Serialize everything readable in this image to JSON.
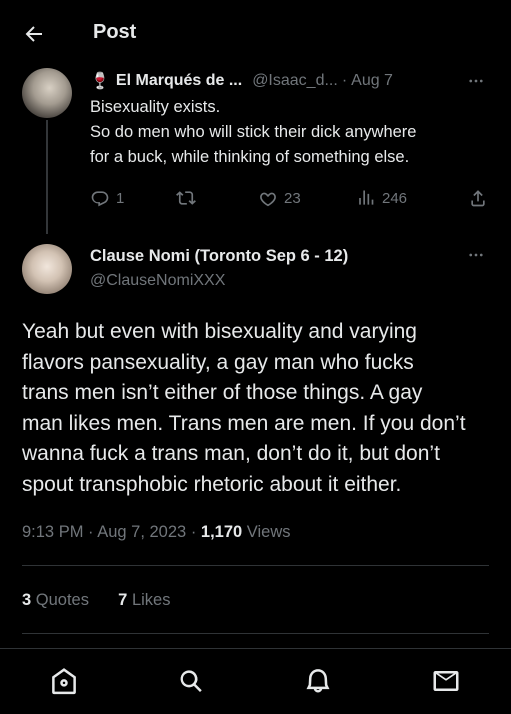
{
  "header": {
    "title": "Post"
  },
  "reply_post": {
    "author_emoji": "🍷",
    "author_name": "El Marqués de ...",
    "handle": "@Isaac_d...",
    "separator": "·",
    "date": "Aug 7",
    "body_lines": [
      "Bisexuality exists.",
      "So do men who will stick their dick anywhere",
      "for a buck, while thinking of something else."
    ],
    "actions": {
      "replies": "1",
      "retweets": "",
      "likes": "23",
      "views": "246"
    }
  },
  "main_post": {
    "author_name": "Clause Nomi (Toronto Sep 6 - 12)",
    "handle": "@ClauseNomiXXX",
    "body_lines": [
      "Yeah but even with bisexuality and varying",
      "flavors pansexuality, a gay man who fucks",
      "trans men isn’t either of those things. A gay",
      "man likes men. Trans men are men. If you don’t",
      "wanna fuck a trans man, don’t do it, but don’t",
      "spout transphobic rhetoric about it either."
    ],
    "time": "9:13 PM",
    "date": "Aug 7, 2023",
    "views_count": "1,170",
    "views_label": "Views",
    "quotes_count": "3",
    "quotes_label": "Quotes",
    "likes_count": "7",
    "likes_label": "Likes"
  },
  "icons": {
    "back": "arrow-left-icon",
    "more": "more-horizontal-icon",
    "reply": "chat-bubble-icon",
    "retweet": "retweet-icon",
    "like": "heart-icon",
    "views": "bar-chart-icon",
    "share": "share-icon",
    "home": "home-icon",
    "search": "search-icon",
    "notifications": "bell-icon",
    "messages": "envelope-icon"
  },
  "colors": {
    "background": "#000000",
    "text": "#e7e9ea",
    "muted": "#71767b",
    "divider": "#2f3336"
  }
}
